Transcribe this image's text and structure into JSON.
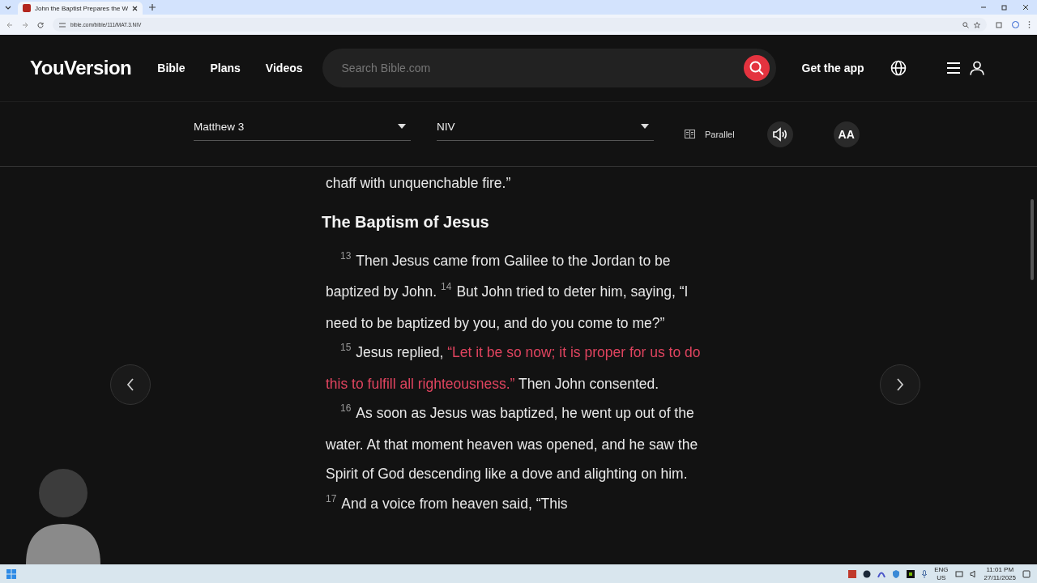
{
  "browser": {
    "tab_title": "John the Baptist Prepares the W",
    "url": "bible.com/bible/111/MAT.3.NIV"
  },
  "header": {
    "logo": "YouVersion",
    "nav": [
      "Bible",
      "Plans",
      "Videos"
    ],
    "search": {
      "placeholder": "Search Bible.com"
    },
    "get_app": "Get the app"
  },
  "reader_bar": {
    "book": "Matthew 3",
    "version": "NIV",
    "parallel": "Parallel",
    "font_button": "AA"
  },
  "passage": {
    "heading": "The Baptism of Jesus",
    "paragraphs": [
      {
        "indent": false,
        "segments": [
          {
            "kind": "text",
            "text": "chaff with unquenchable fire.”"
          }
        ]
      },
      {
        "indent": true,
        "segments": [
          {
            "kind": "verse",
            "text": "13"
          },
          {
            "kind": "text",
            "text": "Then Jesus came from Galilee to the Jordan to be baptized by John. "
          },
          {
            "kind": "verse",
            "text": "14"
          },
          {
            "kind": "text",
            "text": "But John tried to deter him, saying, “I need to be baptized by you, and do you come to me?”"
          }
        ]
      },
      {
        "indent": true,
        "segments": [
          {
            "kind": "verse",
            "text": "15"
          },
          {
            "kind": "text",
            "text": "Jesus replied, "
          },
          {
            "kind": "words_of_jesus",
            "text": "“Let it be so now; it is proper for us to do this to fulfill all righteousness.”"
          },
          {
            "kind": "text",
            "text": " Then John consented."
          }
        ]
      },
      {
        "indent": true,
        "segments": [
          {
            "kind": "verse",
            "text": "16"
          },
          {
            "kind": "text",
            "text": "As soon as Jesus was baptized, he went up out of the water. At that moment heaven was opened, and he saw the Spirit of God descending like a dove and alighting on him. "
          },
          {
            "kind": "verse",
            "text": "17"
          },
          {
            "kind": "text",
            "text": "And a voice from heaven said, “This"
          }
        ]
      }
    ]
  },
  "taskbar": {
    "language": "ENG",
    "region": "US",
    "time": "11:01 PM",
    "date": "27/11/2025"
  }
}
